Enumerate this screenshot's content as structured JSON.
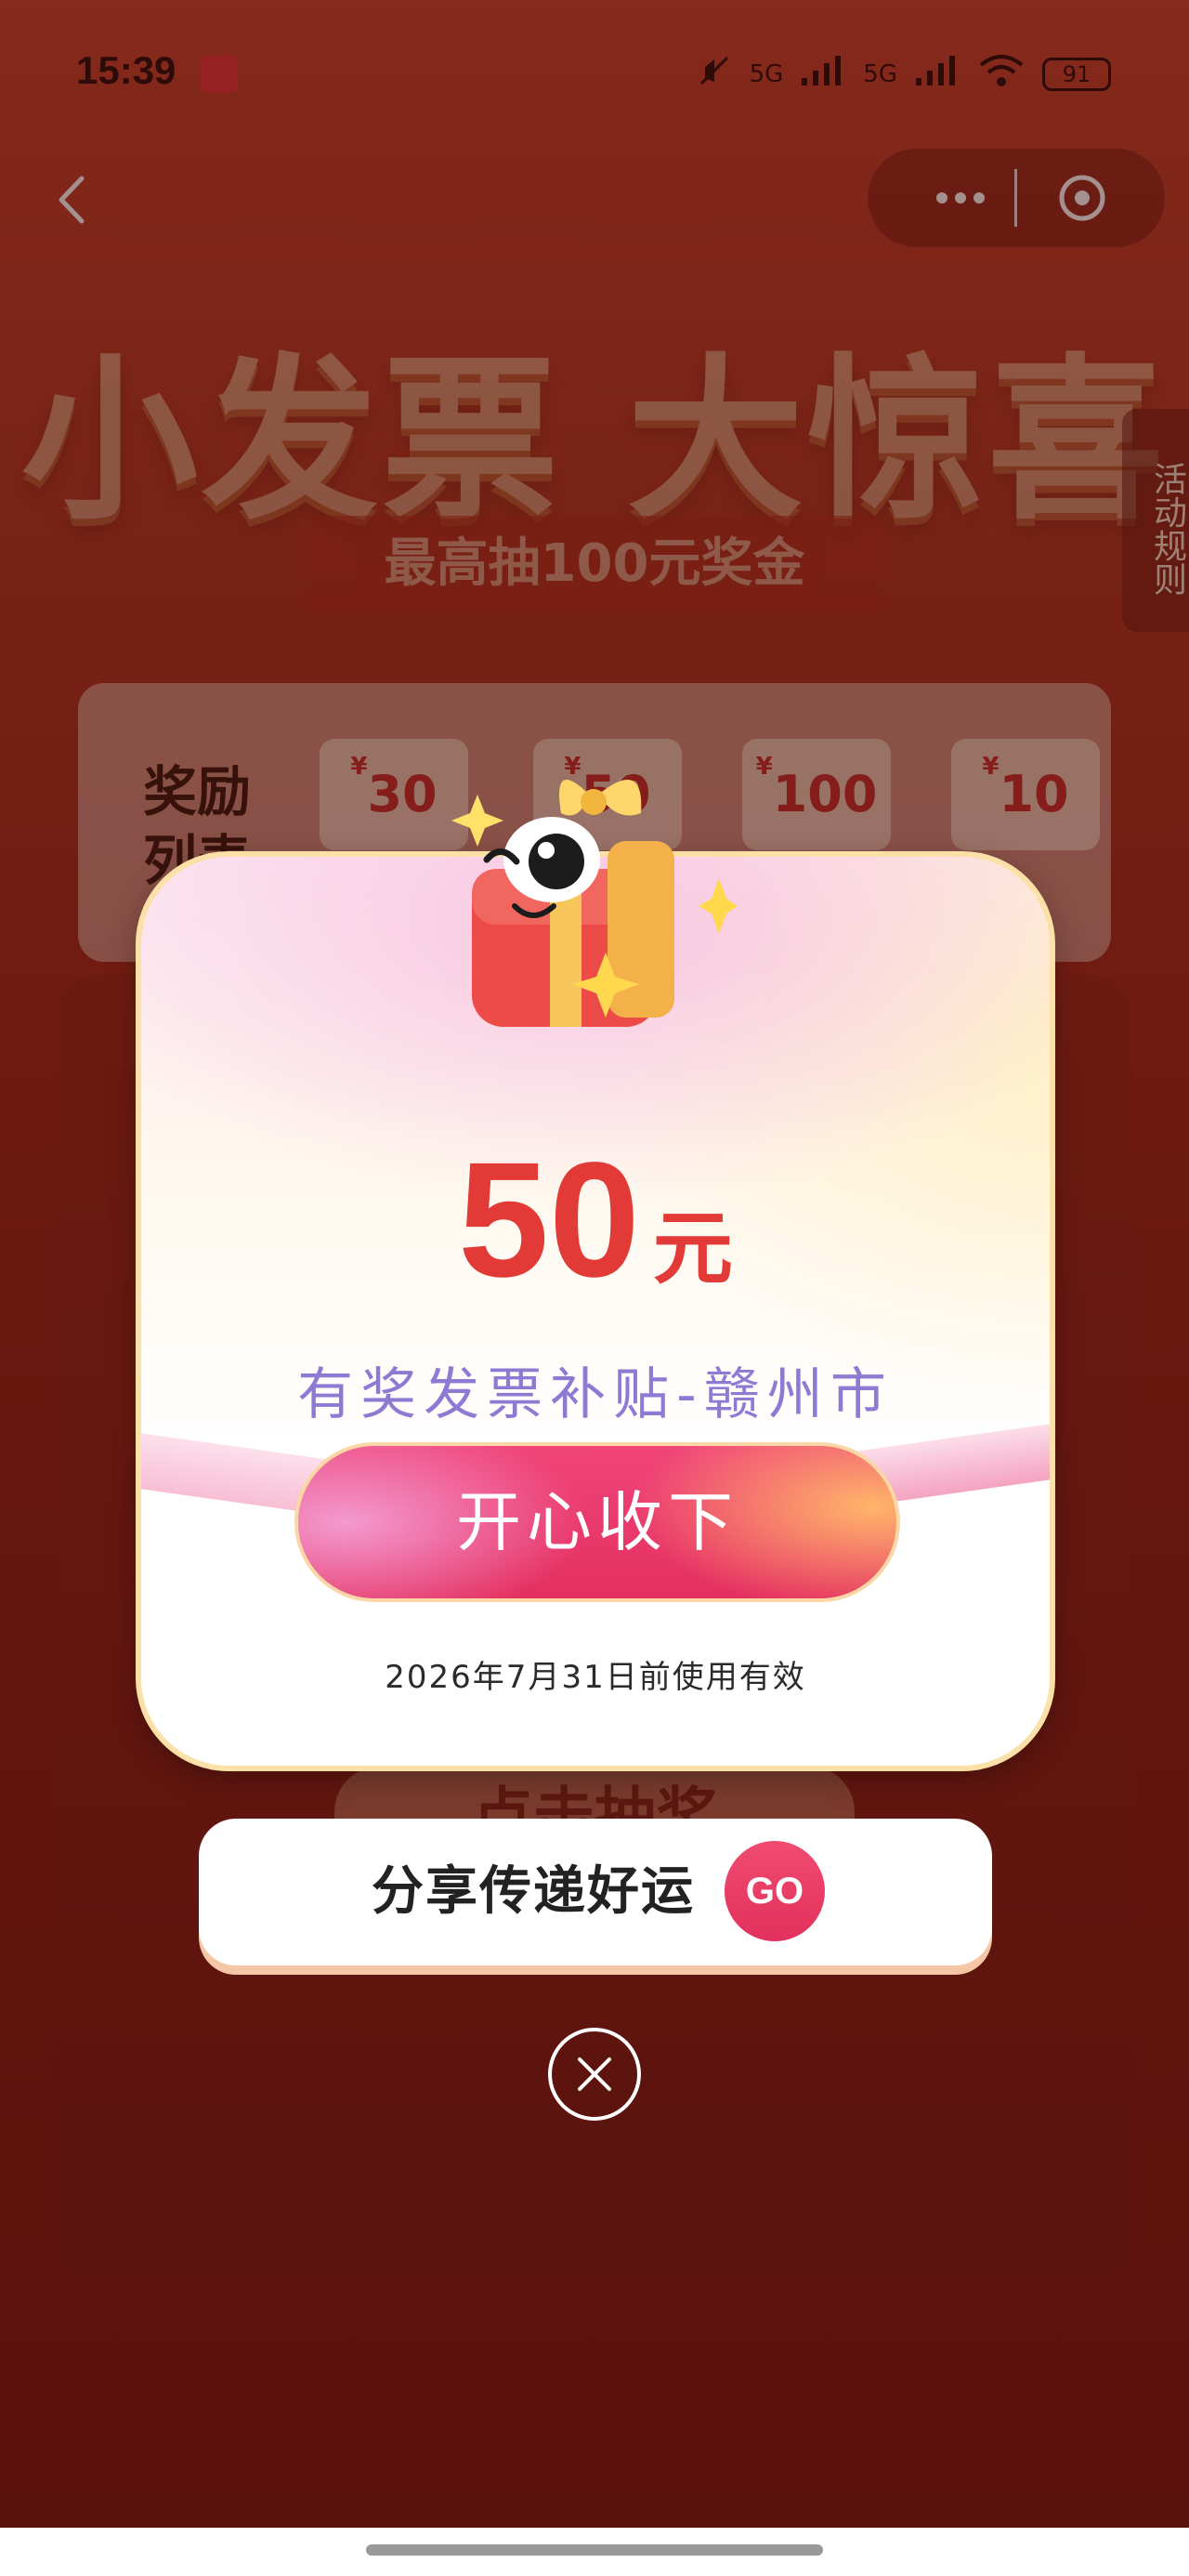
{
  "status_bar": {
    "time": "15:39",
    "battery": "91",
    "signal_1": "5G",
    "signal_2": "5G"
  },
  "hero": {
    "title": "小发票 大惊喜",
    "subtitle": "最高抽100元奖金"
  },
  "side_tab": {
    "rules_label": "活动规则"
  },
  "rewards": {
    "label": "奖励列表",
    "items": [
      {
        "currency": "¥",
        "amount": "30"
      },
      {
        "currency": "¥",
        "amount": "50"
      },
      {
        "currency": "¥",
        "amount": "100"
      },
      {
        "currency": "¥",
        "amount": "10"
      }
    ]
  },
  "background_button": {
    "label": "点击抽奖"
  },
  "modal": {
    "amount": "50",
    "unit": "元",
    "subsidy_name": "有奖发票补贴-赣州市",
    "accept_label": "开心收下",
    "validity": "2026年7月31日前使用有效"
  },
  "share": {
    "label": "分享传递好运",
    "go_label": "GO"
  },
  "colors": {
    "amount_red": "#e23a36",
    "subsidy_purple": "#8c7ad3",
    "button_pink": "#e42f60",
    "background_red": "#a22a1c"
  },
  "icons": {
    "back": "chevron-left-icon",
    "more": "more-dots-icon",
    "close_capsule": "close-circle-icon",
    "close_modal": "close-icon",
    "gift": "gift-mascot-icon"
  }
}
